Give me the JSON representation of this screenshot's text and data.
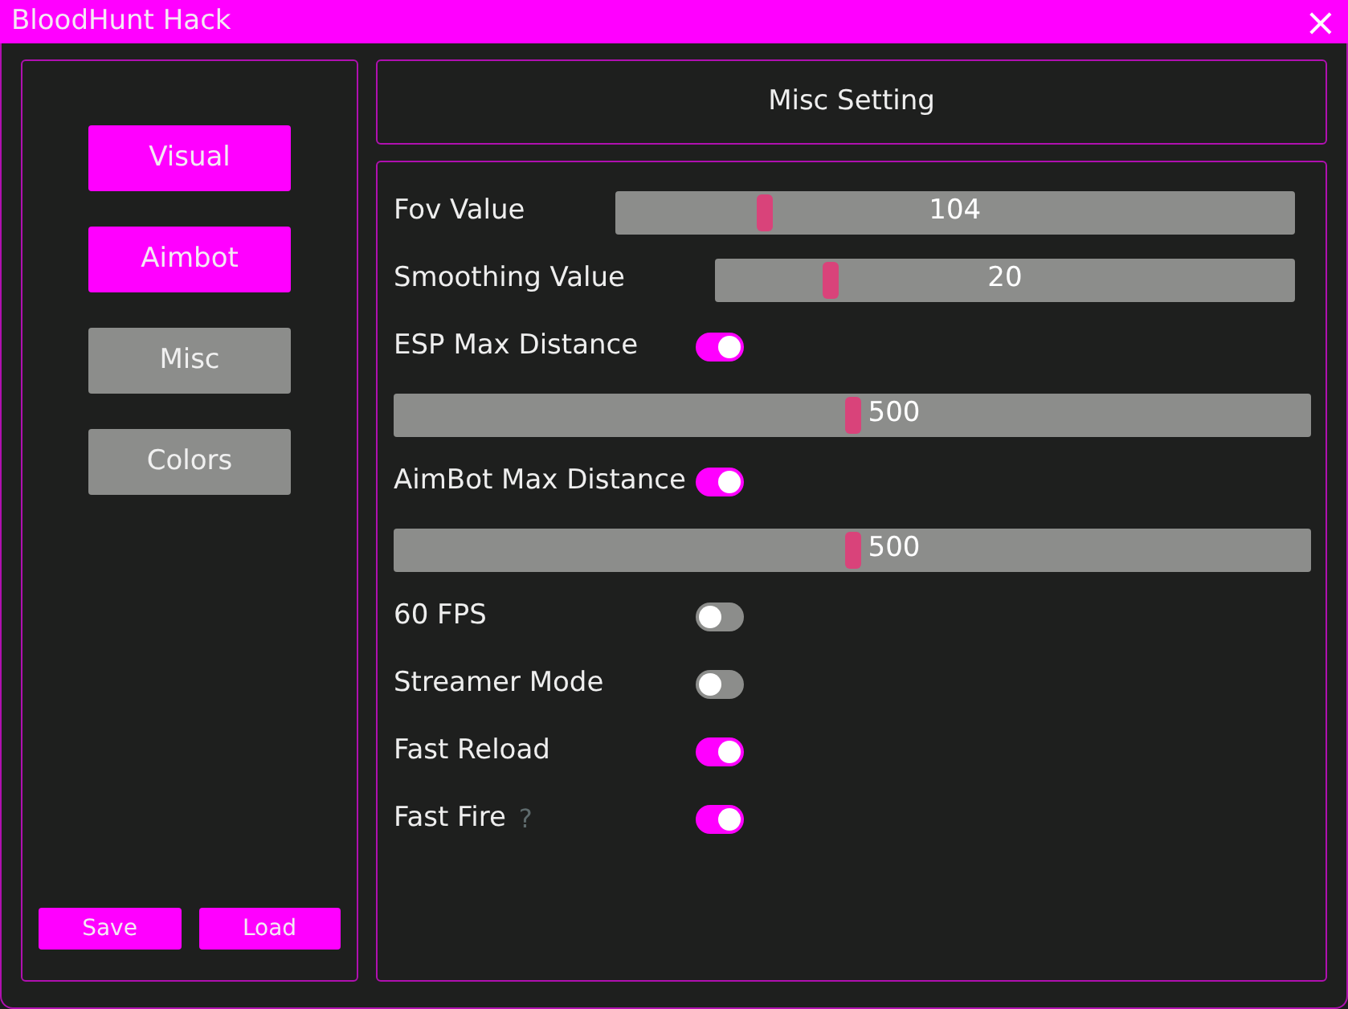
{
  "window": {
    "title": "BloodHunt Hack",
    "close": "×"
  },
  "sidebar": {
    "items": [
      {
        "label": "Visual",
        "active": true
      },
      {
        "label": "Aimbot",
        "active": true
      },
      {
        "label": "Misc",
        "active": false
      },
      {
        "label": "Colors",
        "active": false
      }
    ],
    "buttons": [
      "Save",
      "Load"
    ]
  },
  "header": {
    "title": "Misc Setting"
  },
  "settings": [
    {
      "kind": "slider",
      "label": "Fov Value",
      "value": "104",
      "level": 0.22
    },
    {
      "kind": "slider",
      "label": "Smoothing Value",
      "value": "20",
      "level": 0.2
    },
    {
      "kind": "toggle",
      "label": "ESP Max Distance",
      "on": true
    },
    {
      "kind": "wide_slider",
      "value": "500",
      "level": 0.5
    },
    {
      "kind": "toggle",
      "label": "AimBot Max Distance",
      "on": true
    },
    {
      "kind": "wide_slider",
      "value": "500",
      "level": 0.5
    },
    {
      "kind": "toggle",
      "label": "60 FPS",
      "on": false
    },
    {
      "kind": "toggle",
      "label": "Streamer Mode",
      "on": false
    },
    {
      "kind": "toggle",
      "label": "Fast Reload",
      "on": true
    },
    {
      "kind": "toggle",
      "label": "Fast Fire",
      "hint": "?",
      "on": true
    }
  ]
}
